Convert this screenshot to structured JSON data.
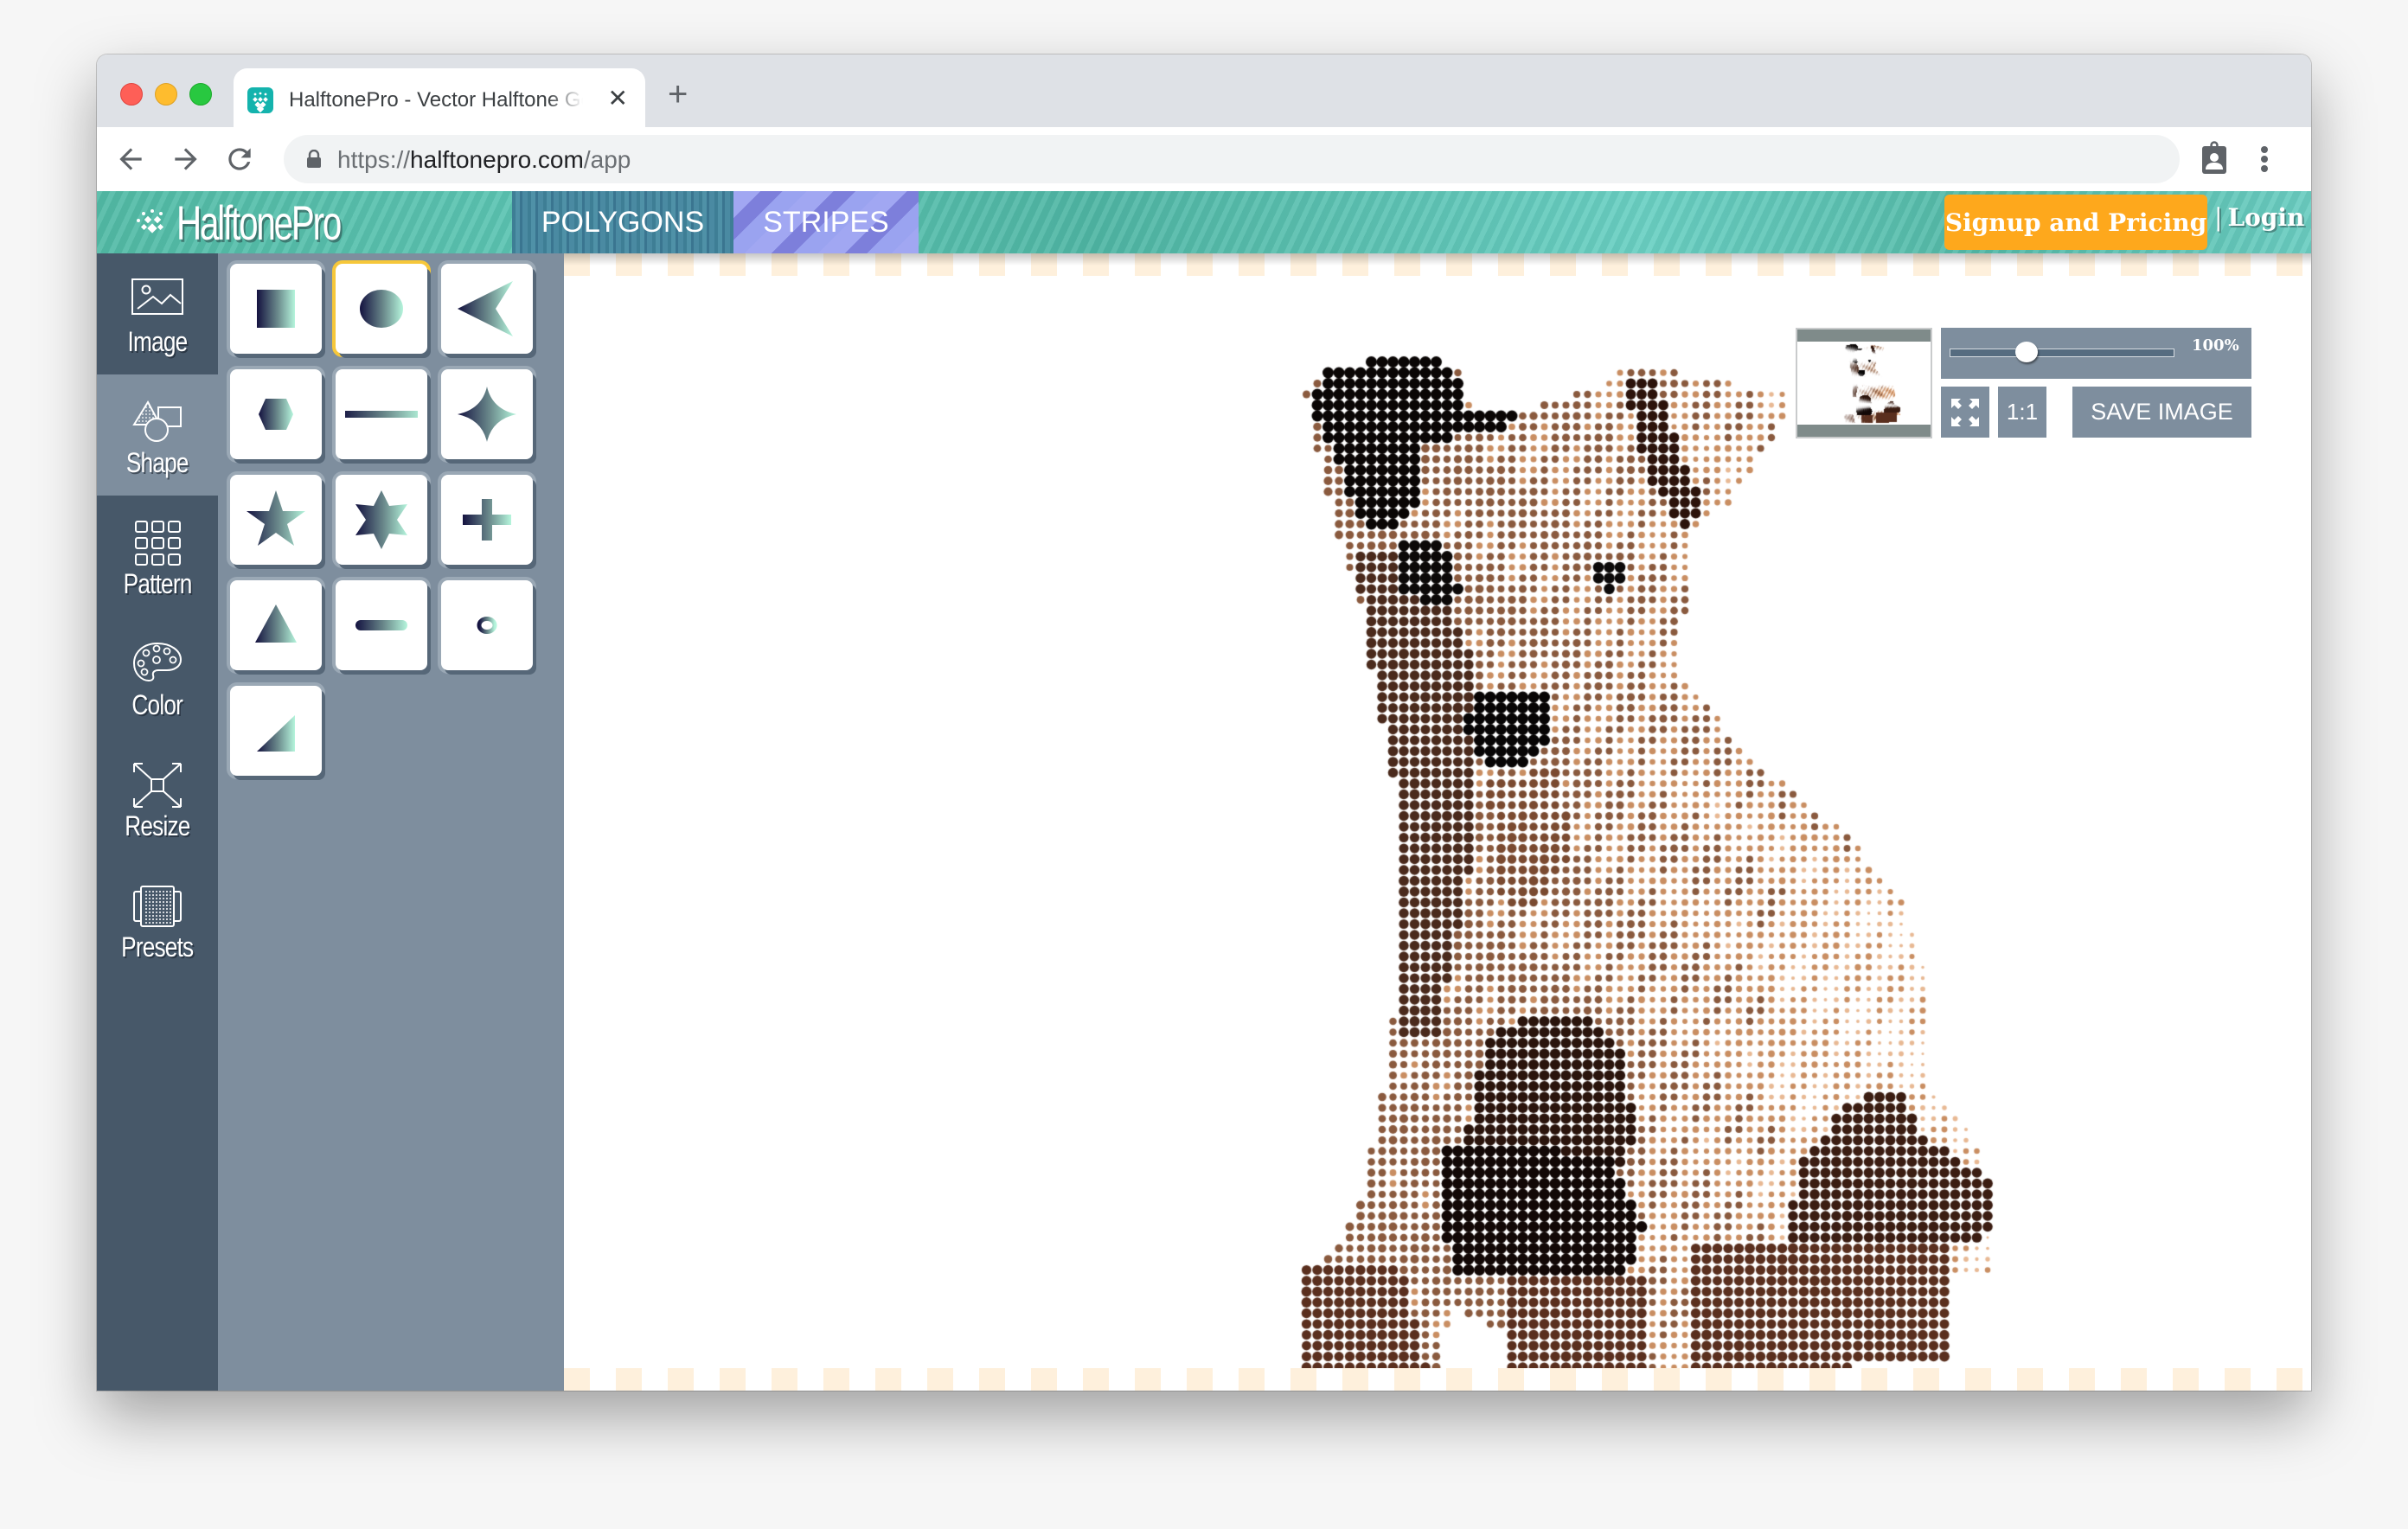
{
  "browser": {
    "tab_title": "HalftonePro - Vector Halftone Generator",
    "tab_favicon": "halftonepro-favicon-icon",
    "new_tab_label": "+",
    "close_tab_label": "✕",
    "url_prefix": "https://",
    "url_host": "halftonepro.com",
    "url_path": "/app",
    "nav": {
      "back": "back-arrow-icon",
      "forward": "forward-arrow-icon",
      "reload": "reload-icon"
    },
    "extensions": [
      "profile-clipboard-icon",
      "more-menu-icon"
    ]
  },
  "header": {
    "logo_text": "HalftonePro",
    "tabs": [
      {
        "label": "POLYGONS",
        "active": false
      },
      {
        "label": "STRIPES",
        "active": false
      }
    ],
    "signup_label": "Signup and Pricing",
    "login_separator": "|",
    "login_label": "Login",
    "accent_color": "#fea81c"
  },
  "sidebar": {
    "items": [
      {
        "label": "Image",
        "icon": "image-icon",
        "active": false
      },
      {
        "label": "Shape",
        "icon": "shapes-icon",
        "active": true
      },
      {
        "label": "Pattern",
        "icon": "grid-pattern-icon",
        "active": false
      },
      {
        "label": "Color",
        "icon": "palette-icon",
        "active": false
      },
      {
        "label": "Resize",
        "icon": "resize-arrows-icon",
        "active": false
      },
      {
        "label": "Presets",
        "icon": "presets-icon",
        "active": false
      }
    ]
  },
  "shapes": {
    "selected": "circle",
    "items": [
      "square",
      "circle",
      "arrowhead",
      "hexagon",
      "line",
      "four-point-star",
      "star",
      "six-point-star",
      "cross",
      "triangle",
      "rounded-bar",
      "ring",
      "right-triangle"
    ],
    "gradient_colors": [
      "#141240",
      "#b5f5dc"
    ],
    "selected_border_color": "#f6c73a"
  },
  "canvas": {
    "subject": "halftone dog (circle dots)",
    "zoom_percent": 100,
    "zoom_slider_position": 0.34,
    "zoom_label": "100%",
    "fit_button_icon": "fit-to-screen-icon",
    "actual_size_label": "1:1",
    "save_label": "SAVE IMAGE"
  }
}
